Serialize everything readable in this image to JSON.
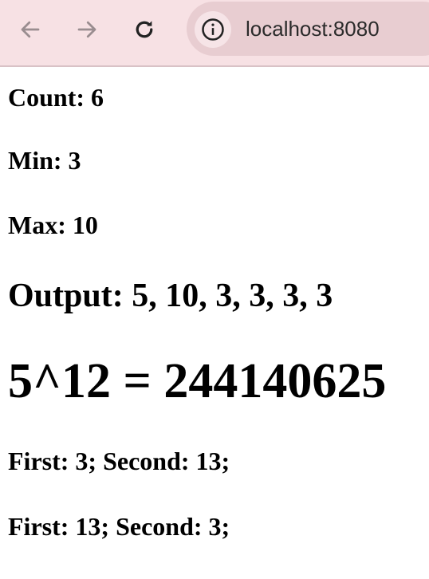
{
  "browser": {
    "url": "localhost:8080",
    "toolbar_color": "#f7e1e4"
  },
  "page": {
    "count": "Count: 6",
    "min": "Min: 3",
    "max": "Max: 10",
    "output": "Output: 5, 10, 3, 3, 3, 3",
    "power": "5^12 = 244140625",
    "pair1": "First: 3; Second: 13;",
    "pair2": "First: 13; Second: 3;"
  }
}
